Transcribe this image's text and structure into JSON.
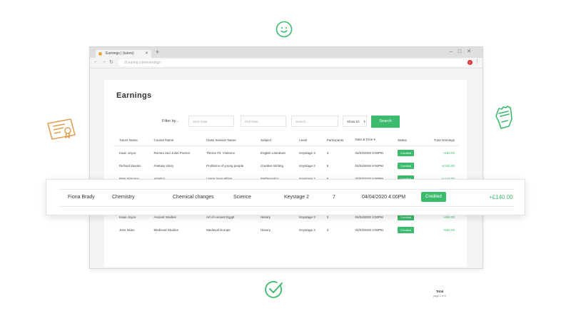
{
  "browser": {
    "tab_title": "Earnings | (tutors)",
    "url": "2Learing.com/earnings",
    "extension_badge": "1"
  },
  "page": {
    "title": "Earnings",
    "filter_label": "Filter by...",
    "start_date_placeholder": "Start Date",
    "end_date_placeholder": "End Date",
    "search_placeholder": "Search...",
    "show_select": "Show 10",
    "search_button": "Search",
    "columns": [
      "Tutors Name",
      "Course Name",
      "Class Session Name",
      "Subject",
      "Level",
      "Participants",
      "Date & Time",
      "Status",
      "Tutor Earnings"
    ],
    "rows_top": [
      [
        "Kaan Joyce",
        "Romeo and Juliet Poems",
        "Theme #3. Violence",
        "English Literature",
        "Keystage 3",
        "3",
        "04/04/2020 8:00PM",
        "Credited",
        "+£60.00"
      ],
      [
        "Richard Davies",
        "Fantasy Story",
        "Problems of young people",
        "Creative Writing",
        "Keystage 2",
        "6",
        "04/04/2020 8:00PM",
        "Credited",
        "+£120.00"
      ],
      [
        "Pete Simpson",
        "Algebra",
        "Linear inequalities",
        "Mathematics",
        "Keystage 2",
        "6",
        "04/04/2020 8:00PM",
        "Credited",
        "+£120.00"
      ]
    ],
    "rows_bottom": [
      [
        "Kaan Joyce",
        "Ancient Studies",
        "Art of Ancient Egypt",
        "History",
        "Keystage 3",
        "3",
        "04/04/2020 3:00PM",
        "Credited",
        "+£60.00"
      ],
      [
        "Jess Skies",
        "Medieval Studies",
        "Medieval Europe",
        "History",
        "Keystage 3",
        "3",
        "04/04/2020 3:00PM",
        "Credited",
        "+£60.00"
      ]
    ],
    "total_label": "Total",
    "page_of": "page 1 of 6"
  },
  "highlight_row": {
    "tutor": "Fiona Brady",
    "course": "Chemistry",
    "session": "Chemical changes",
    "subject": "Science",
    "level": "Keystage 2",
    "participants": "7",
    "datetime": "04/04/2020 4:00PM",
    "status": "Credited",
    "earnings": "+£140.00"
  },
  "colors": {
    "accent": "#3cba6d",
    "icon_orange": "#e0a050"
  }
}
